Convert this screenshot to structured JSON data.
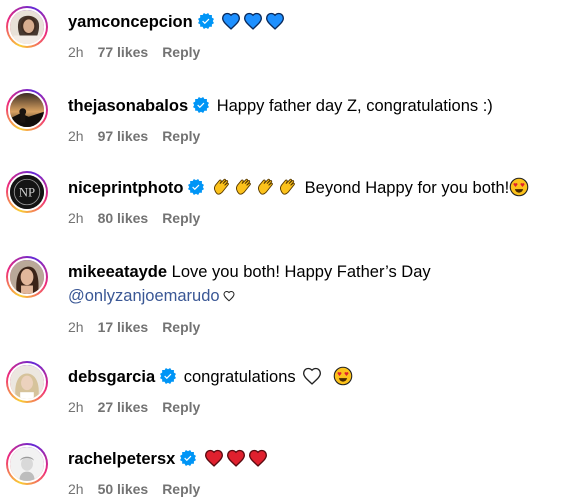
{
  "comments": [
    {
      "username": "yamconcepcion",
      "verified": true,
      "text": "",
      "emojis": [
        "blue-heart-icon",
        "blue-heart-icon",
        "blue-heart-icon"
      ],
      "time": "2h",
      "likes": "77 likes",
      "reply": "Reply"
    },
    {
      "username": "thejasonabalos",
      "verified": true,
      "text": "Happy father day Z, congratulations :)",
      "time": "2h",
      "likes": "97 likes",
      "reply": "Reply"
    },
    {
      "username": "niceprintphoto",
      "verified": true,
      "avatar_initials": "NP",
      "emojis": [
        "clapping-hands-icon",
        "clapping-hands-icon",
        "clapping-hands-icon",
        "clapping-hands-icon"
      ],
      "text": "Beyond Happy for you both!",
      "emojis_after": [
        "heart-eyes-icon"
      ],
      "time": "2h",
      "likes": "80 likes",
      "reply": "Reply"
    },
    {
      "username": "mikeeatayde",
      "verified": false,
      "text": "Love you both! Happy Father’s Day",
      "mention": "@onlyzanjoemarudo",
      "time": "2h",
      "likes": "17 likes",
      "reply": "Reply"
    },
    {
      "username": "debsgarcia",
      "verified": true,
      "text": "congratulations",
      "emojis_after": [
        "white-heart-icon",
        "heart-eyes-icon"
      ],
      "time": "2h",
      "likes": "27 likes",
      "reply": "Reply"
    },
    {
      "username": "rachelpetersx",
      "verified": true,
      "text": "",
      "emojis": [
        "red-heart-icon",
        "red-heart-icon",
        "red-heart-icon"
      ],
      "time": "2h",
      "likes": "50 likes",
      "reply": "Reply"
    }
  ],
  "colors": {
    "verified": "#0095f6",
    "meta": "#737373",
    "mention": "#3a5795",
    "blue_heart": "#1e90ff",
    "red_heart": "#e0202e",
    "emoji_yellow": "#fcc21b"
  }
}
